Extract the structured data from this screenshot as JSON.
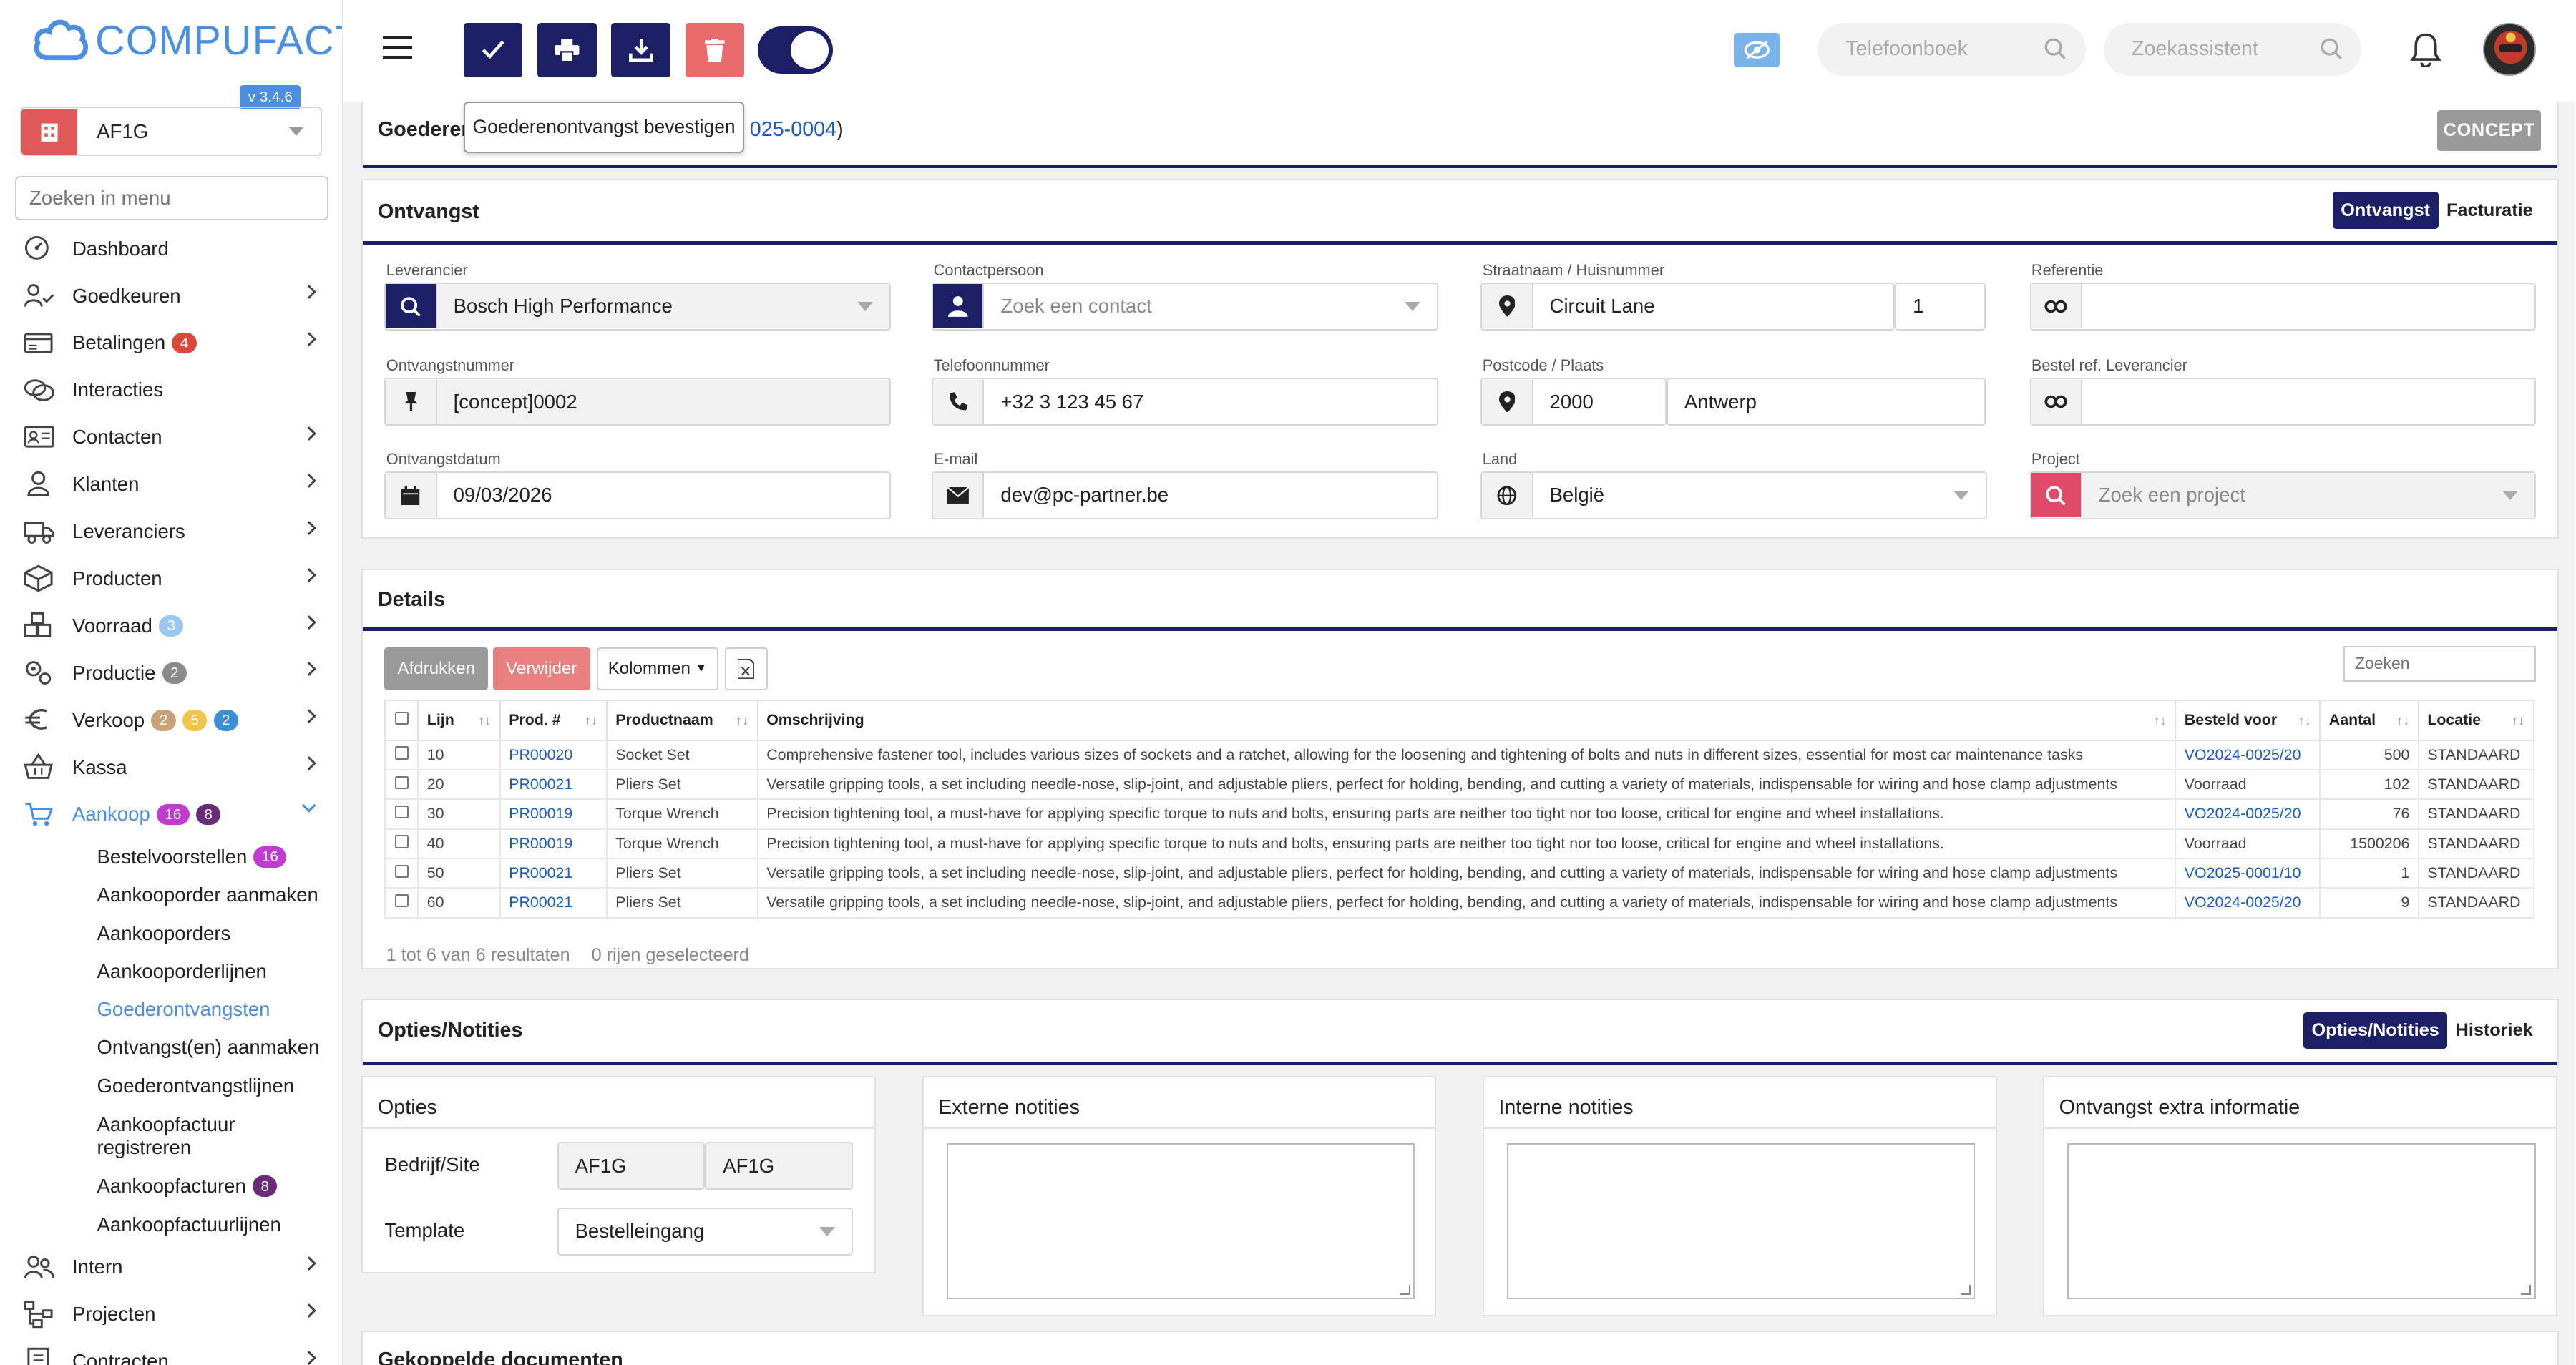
{
  "app": {
    "logo_text": "COMPUFACT",
    "version": "v 3.4.6",
    "company": "AF1G",
    "menu_search_placeholder": "Zoeken in menu"
  },
  "colors": {
    "primary": "#1a1f66",
    "accent": "#4a8fe0",
    "danger": "#e05858",
    "concept": "#9a9a9a"
  },
  "nav": [
    {
      "label": "Dashboard",
      "icon": "dashboard-icon"
    },
    {
      "label": "Goedkeuren",
      "icon": "user-check-icon",
      "chevron": true
    },
    {
      "label": "Betalingen",
      "icon": "payments-icon",
      "chevron": true,
      "badges": [
        {
          "v": "4",
          "c": "#d9463a"
        }
      ]
    },
    {
      "label": "Interacties",
      "icon": "chat-icon"
    },
    {
      "label": "Contacten",
      "icon": "contact-card-icon",
      "chevron": true
    },
    {
      "label": "Klanten",
      "icon": "customer-icon",
      "chevron": true
    },
    {
      "label": "Leveranciers",
      "icon": "truck-icon",
      "chevron": true
    },
    {
      "label": "Producten",
      "icon": "box-icon",
      "chevron": true
    },
    {
      "label": "Voorraad",
      "icon": "stock-icon",
      "chevron": true,
      "badges": [
        {
          "v": "3",
          "c": "#9cc7ef"
        }
      ]
    },
    {
      "label": "Productie",
      "icon": "production-icon",
      "chevron": true,
      "badges": [
        {
          "v": "2",
          "c": "#8a8a8a"
        }
      ]
    },
    {
      "label": "Verkoop",
      "icon": "euro-icon",
      "chevron": true,
      "badges": [
        {
          "v": "2",
          "c": "#c9a27a"
        },
        {
          "v": "5",
          "c": "#f2c44a"
        },
        {
          "v": "2",
          "c": "#3a8fd6"
        }
      ]
    },
    {
      "label": "Kassa",
      "icon": "basket-icon",
      "chevron": true
    },
    {
      "label": "Aankoop",
      "icon": "cart-icon",
      "chevron": true,
      "active": true,
      "badges": [
        {
          "v": "16",
          "c": "#c23bd1"
        },
        {
          "v": "8",
          "c": "#6a2a7a"
        }
      ]
    }
  ],
  "subnav": [
    {
      "label": "Bestelvoorstellen",
      "badge": "16",
      "badge_color": "#c23bd1"
    },
    {
      "label": "Aankooporder aanmaken"
    },
    {
      "label": "Aankooporders"
    },
    {
      "label": "Aankooporderlijnen"
    },
    {
      "label": "Goederontvangsten",
      "active": true
    },
    {
      "label": "Ontvangst(en) aanmaken"
    },
    {
      "label": "Goederontvangstlijnen"
    },
    {
      "label": "Aankoopfactuur registreren",
      "two": true
    },
    {
      "label": "Aankoopfacturen",
      "badge": "8",
      "badge_color": "#6a2a7a"
    },
    {
      "label": "Aankoopfactuurlijnen"
    }
  ],
  "nav_bottom": [
    {
      "label": "Intern",
      "icon": "team-icon",
      "chevron": true
    },
    {
      "label": "Projecten",
      "icon": "project-icon",
      "chevron": true
    },
    {
      "label": "Contracten",
      "icon": "contract-icon",
      "chevron": true
    }
  ],
  "topbar": {
    "phonebook_placeholder": "Telefoonboek",
    "assistant_placeholder": "Zoekassistent"
  },
  "header": {
    "title_prefix": "Goederen",
    "title_link": "025-0004",
    "title_suffix": ")",
    "status": "CONCEPT",
    "tooltip": "Goederenontvangst bevestigen"
  },
  "ontvangst": {
    "title": "Ontvangst",
    "tab_active": "Ontvangst",
    "tab_other": "Facturatie",
    "leverancier_label": "Leverancier",
    "leverancier": "Bosch High Performance",
    "contact_label": "Contactpersoon",
    "contact_placeholder": "Zoek een contact",
    "street_label": "Straatnaam / Huisnummer",
    "street": "Circuit Lane",
    "number": "1",
    "ref_label": "Referentie",
    "ref": "",
    "nr_label": "Ontvangstnummer",
    "nr": "[concept]0002",
    "phone_label": "Telefoonnummer",
    "phone": "+32 3 123 45 67",
    "postcode_label": "Postcode / Plaats",
    "postcode": "2000",
    "city": "Antwerp",
    "bestelref_label": "Bestel ref. Leverancier",
    "bestelref": "",
    "date_label": "Ontvangstdatum",
    "date": "09/03/2026",
    "email_label": "E-mail",
    "email": "dev@pc-partner.be",
    "land_label": "Land",
    "land": "België",
    "project_label": "Project",
    "project_placeholder": "Zoek een project"
  },
  "details": {
    "title": "Details",
    "btn_print": "Afdrukken",
    "btn_delete": "Verwijder",
    "btn_columns": "Kolommen",
    "search_placeholder": "Zoeken",
    "columns": [
      "Lijn",
      "Prod. #",
      "Productnaam",
      "Omschrijving",
      "Besteld voor",
      "Aantal",
      "Locatie"
    ],
    "rows": [
      {
        "lijn": "10",
        "prod": "PR00020",
        "naam": "Socket Set",
        "omschr": "Comprehensive fastener tool, includes various sizes of sockets and a ratchet, allowing for the loosening and tightening of bolts and nuts in different sizes, essential for most car maintenance tasks",
        "besteld": "VO2024-0025/20",
        "link": true,
        "aantal": "500",
        "locatie": "STANDAARD"
      },
      {
        "lijn": "20",
        "prod": "PR00021",
        "naam": "Pliers Set",
        "omschr": "Versatile gripping tools, a set including needle-nose, slip-joint, and adjustable pliers, perfect for holding, bending, and cutting a variety of materials, indispensable for wiring and hose clamp adjustments",
        "besteld": "Voorraad",
        "link": false,
        "aantal": "102",
        "locatie": "STANDAARD"
      },
      {
        "lijn": "30",
        "prod": "PR00019",
        "naam": "Torque Wrench",
        "omschr": "Precision tightening tool, a must-have for applying specific torque to nuts and bolts, ensuring parts are neither too tight nor too loose, critical for engine and wheel installations.",
        "besteld": "VO2024-0025/20",
        "link": true,
        "aantal": "76",
        "locatie": "STANDAARD"
      },
      {
        "lijn": "40",
        "prod": "PR00019",
        "naam": "Torque Wrench",
        "omschr": "Precision tightening tool, a must-have for applying specific torque to nuts and bolts, ensuring parts are neither too tight nor too loose, critical for engine and wheel installations.",
        "besteld": "Voorraad",
        "link": false,
        "aantal": "1500206",
        "locatie": "STANDAARD"
      },
      {
        "lijn": "50",
        "prod": "PR00021",
        "naam": "Pliers Set",
        "omschr": "Versatile gripping tools, a set including needle-nose, slip-joint, and adjustable pliers, perfect for holding, bending, and cutting a variety of materials, indispensable for wiring and hose clamp adjustments",
        "besteld": "VO2025-0001/10",
        "link": true,
        "aantal": "1",
        "locatie": "STANDAARD"
      },
      {
        "lijn": "60",
        "prod": "PR00021",
        "naam": "Pliers Set",
        "omschr": "Versatile gripping tools, a set including needle-nose, slip-joint, and adjustable pliers, perfect for holding, bending, and cutting a variety of materials, indispensable for wiring and hose clamp adjustments",
        "besteld": "VO2024-0025/20",
        "link": true,
        "aantal": "9",
        "locatie": "STANDAARD"
      }
    ],
    "footer_results": "1 tot 6 van 6 resultaten",
    "footer_selected": "0 rijen geselecteerd"
  },
  "opties": {
    "title": "Opties/Notities",
    "tab_active": "Opties/Notities",
    "tab_other": "Historiek",
    "opties_title": "Opties",
    "bedrijf_label": "Bedrijf/Site",
    "bedrijf1": "AF1G",
    "bedrijf2": "AF1G",
    "template_label": "Template",
    "template": "Bestelleingang",
    "externe": "Externe notities",
    "interne": "Interne notities",
    "extra": "Ontvangst extra informatie"
  },
  "docs": {
    "title": "Gekoppelde documenten"
  }
}
